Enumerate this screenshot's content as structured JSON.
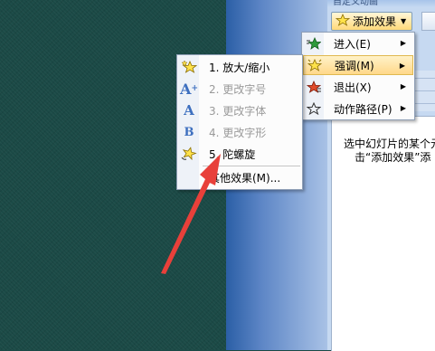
{
  "pane": {
    "header_partial": "自定义动画",
    "add_effect_label": "添加效果",
    "hint_line1": "选中幻灯片的某个元",
    "hint_line2": "击“添加效果”添"
  },
  "add_effect_menu": {
    "items": [
      {
        "label": "进入(E)",
        "icon": "green-star-icon",
        "highlighted": false
      },
      {
        "label": "强调(M)",
        "icon": "yellow-star-icon",
        "highlighted": true
      },
      {
        "label": "退出(X)",
        "icon": "red-star-icon",
        "highlighted": false
      },
      {
        "label": "动作路径(P)",
        "icon": "star-outline-path-icon",
        "highlighted": false
      }
    ]
  },
  "emphasis_menu": {
    "items": [
      {
        "label": "1. 放大/缩小",
        "icon": "grow-shrink-star-icon",
        "enabled": true
      },
      {
        "label": "2. 更改字号",
        "icon": "font-size-icon",
        "enabled": false
      },
      {
        "label": "3. 更改字体",
        "icon": "font-face-icon",
        "enabled": false
      },
      {
        "label": "4. 更改字形",
        "icon": "font-style-icon",
        "enabled": false
      },
      {
        "label": "5. 陀螺旋",
        "icon": "spin-star-icon",
        "enabled": true
      },
      {
        "label": "其他效果(M)...",
        "icon": "",
        "enabled": true
      }
    ]
  },
  "annotation": {
    "arrow_color": "#e8403a"
  },
  "colors": {
    "slide_background": "#1b4a46",
    "task_pane": "#c6d9f1",
    "highlight": "#ffd88a"
  }
}
